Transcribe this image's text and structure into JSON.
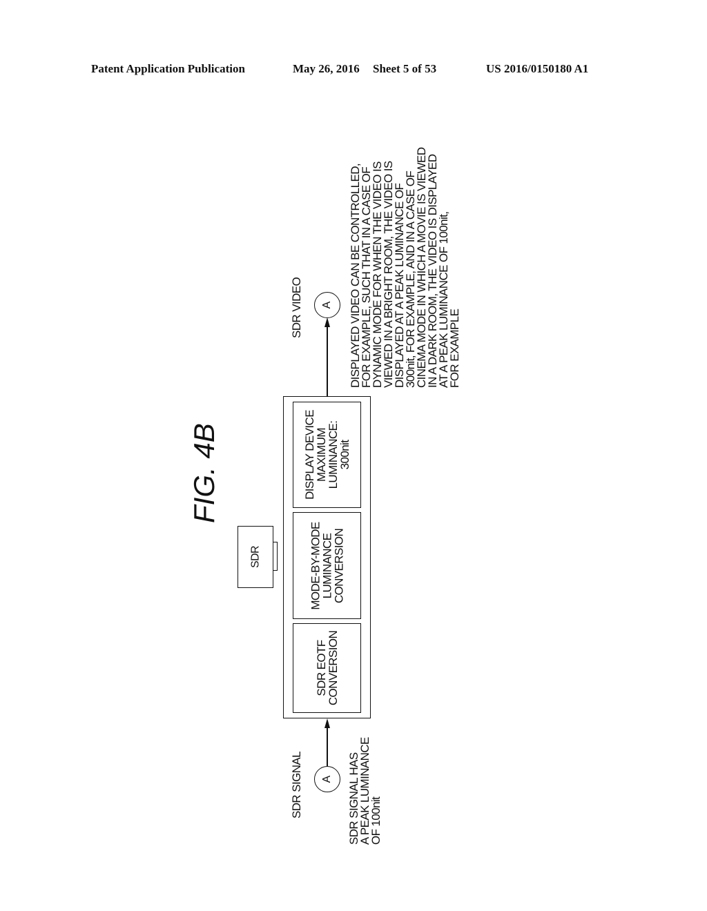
{
  "header": {
    "publication": "Patent Application Publication",
    "date": "May 26, 2016",
    "sheet": "Sheet 5 of 53",
    "number": "US 2016/0150180 A1"
  },
  "figure": {
    "title": "FIG. 4B",
    "source_box_label": "SDR",
    "input": {
      "label": "SDR SIGNAL",
      "connector": "A",
      "note_lines": [
        "SDR SIGNAL HAS",
        "A PEAK LUMINANCE",
        "OF 100nit"
      ]
    },
    "output": {
      "label": "SDR VIDEO",
      "connector": "A",
      "note_lines": [
        "DISPLAYED VIDEO CAN BE CONTROLLED,",
        "FOR EXAMPLE, SUCH THAT IN A CASE OF",
        "DYNAMIC MODE FOR WHEN THE VIDEO IS",
        "VIEWED IN A BRIGHT ROOM, THE VIDEO IS",
        "DISPLAYED AT A PEAK LUMINANCE OF",
        "300nit, FOR EXAMPLE, AND IN A CASE OF",
        "CINEMA MODE IN WHICH A MOVIE IS VIEWED",
        "IN A DARK ROOM, THE VIDEO IS DISPLAYED",
        "AT A PEAK LUMINANCE OF 100nit,",
        "FOR EXAMPLE"
      ]
    },
    "blocks": [
      {
        "lines": [
          "SDR EOTF",
          "CONVERSION"
        ]
      },
      {
        "lines": [
          "MODE-BY-MODE",
          "LUMINANCE",
          "CONVERSION"
        ]
      },
      {
        "lines": [
          "DISPLAY DEVICE",
          "MAXIMUM",
          "LUMINANCE:",
          "300nit"
        ]
      }
    ]
  }
}
